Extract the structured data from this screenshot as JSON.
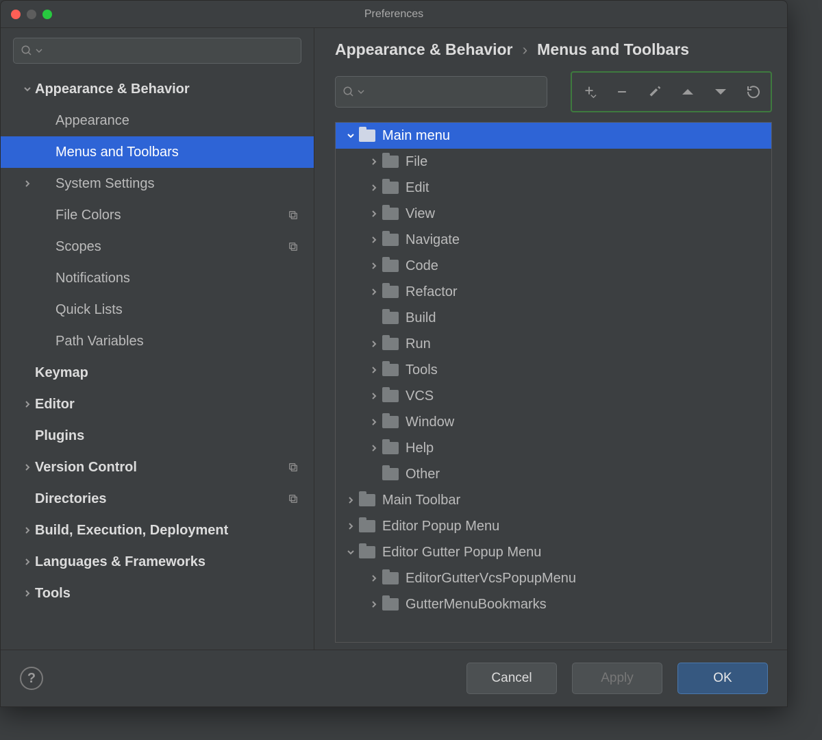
{
  "window": {
    "title": "Preferences"
  },
  "search": {
    "placeholder": ""
  },
  "sidebar": {
    "items": [
      {
        "label": "Appearance & Behavior",
        "indent": 0,
        "chevron": "down",
        "bold": true,
        "selected": false,
        "suffix": ""
      },
      {
        "label": "Appearance",
        "indent": 1,
        "chevron": "",
        "bold": false,
        "selected": false,
        "suffix": ""
      },
      {
        "label": "Menus and Toolbars",
        "indent": 1,
        "chevron": "",
        "bold": false,
        "selected": true,
        "suffix": ""
      },
      {
        "label": "System Settings",
        "indent": 1,
        "chevron": "right",
        "bold": false,
        "selected": false,
        "suffix": ""
      },
      {
        "label": "File Colors",
        "indent": 1,
        "chevron": "",
        "bold": false,
        "selected": false,
        "suffix": "copy"
      },
      {
        "label": "Scopes",
        "indent": 1,
        "chevron": "",
        "bold": false,
        "selected": false,
        "suffix": "copy"
      },
      {
        "label": "Notifications",
        "indent": 1,
        "chevron": "",
        "bold": false,
        "selected": false,
        "suffix": ""
      },
      {
        "label": "Quick Lists",
        "indent": 1,
        "chevron": "",
        "bold": false,
        "selected": false,
        "suffix": ""
      },
      {
        "label": "Path Variables",
        "indent": 1,
        "chevron": "",
        "bold": false,
        "selected": false,
        "suffix": ""
      },
      {
        "label": "Keymap",
        "indent": 0,
        "chevron": "",
        "bold": true,
        "selected": false,
        "suffix": ""
      },
      {
        "label": "Editor",
        "indent": 0,
        "chevron": "right",
        "bold": true,
        "selected": false,
        "suffix": ""
      },
      {
        "label": "Plugins",
        "indent": 0,
        "chevron": "",
        "bold": true,
        "selected": false,
        "suffix": ""
      },
      {
        "label": "Version Control",
        "indent": 0,
        "chevron": "right",
        "bold": true,
        "selected": false,
        "suffix": "copy"
      },
      {
        "label": "Directories",
        "indent": 0,
        "chevron": "",
        "bold": true,
        "selected": false,
        "suffix": "copy"
      },
      {
        "label": "Build, Execution, Deployment",
        "indent": 0,
        "chevron": "right",
        "bold": true,
        "selected": false,
        "suffix": ""
      },
      {
        "label": "Languages & Frameworks",
        "indent": 0,
        "chevron": "right",
        "bold": true,
        "selected": false,
        "suffix": ""
      },
      {
        "label": "Tools",
        "indent": 0,
        "chevron": "right",
        "bold": true,
        "selected": false,
        "suffix": ""
      }
    ]
  },
  "breadcrumb": {
    "a": "Appearance & Behavior",
    "b": "Menus and Toolbars"
  },
  "toolbar": {
    "add": "add-icon",
    "remove": "remove-icon",
    "edit": "edit-icon",
    "up": "up-icon",
    "down": "down-icon",
    "reset": "reset-icon"
  },
  "menu_tree": [
    {
      "label": "Main menu",
      "indent": 0,
      "chevron": "down",
      "selected": true
    },
    {
      "label": "File",
      "indent": 1,
      "chevron": "right",
      "selected": false
    },
    {
      "label": "Edit",
      "indent": 1,
      "chevron": "right",
      "selected": false
    },
    {
      "label": "View",
      "indent": 1,
      "chevron": "right",
      "selected": false
    },
    {
      "label": "Navigate",
      "indent": 1,
      "chevron": "right",
      "selected": false
    },
    {
      "label": "Code",
      "indent": 1,
      "chevron": "right",
      "selected": false
    },
    {
      "label": "Refactor",
      "indent": 1,
      "chevron": "right",
      "selected": false
    },
    {
      "label": "Build",
      "indent": 1,
      "chevron": "",
      "selected": false
    },
    {
      "label": "Run",
      "indent": 1,
      "chevron": "right",
      "selected": false
    },
    {
      "label": "Tools",
      "indent": 1,
      "chevron": "right",
      "selected": false
    },
    {
      "label": "VCS",
      "indent": 1,
      "chevron": "right",
      "selected": false
    },
    {
      "label": "Window",
      "indent": 1,
      "chevron": "right",
      "selected": false
    },
    {
      "label": "Help",
      "indent": 1,
      "chevron": "right",
      "selected": false
    },
    {
      "label": "Other",
      "indent": 1,
      "chevron": "",
      "selected": false
    },
    {
      "label": "Main Toolbar",
      "indent": 0,
      "chevron": "right",
      "selected": false
    },
    {
      "label": "Editor Popup Menu",
      "indent": 0,
      "chevron": "right",
      "selected": false
    },
    {
      "label": "Editor Gutter Popup Menu",
      "indent": 0,
      "chevron": "down",
      "selected": false
    },
    {
      "label": "EditorGutterVcsPopupMenu",
      "indent": 1,
      "chevron": "right",
      "selected": false
    },
    {
      "label": "GutterMenuBookmarks",
      "indent": 1,
      "chevron": "right",
      "selected": false
    }
  ],
  "footer": {
    "cancel": "Cancel",
    "apply": "Apply",
    "ok": "OK"
  }
}
